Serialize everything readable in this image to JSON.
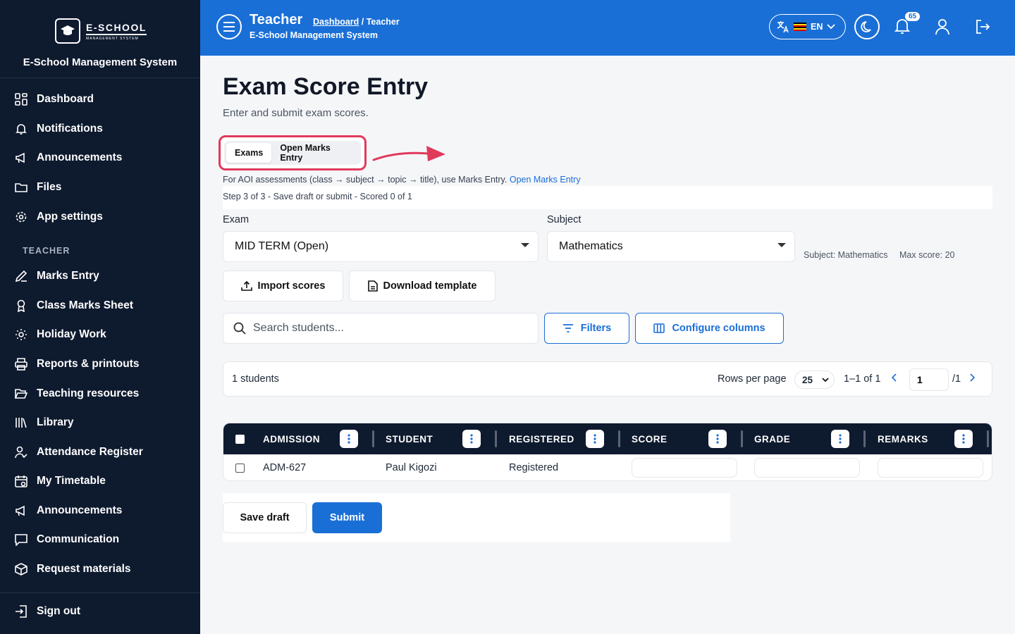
{
  "brand": {
    "logo_line1": "E-SCHOOL",
    "logo_line2": "MANAGEMENT SYSTEM",
    "system_name": "E-School Management System"
  },
  "sidebar": {
    "general": [
      {
        "label": "Dashboard",
        "icon": "dashboard-icon"
      },
      {
        "label": "Notifications",
        "icon": "bell-icon"
      },
      {
        "label": "Announcements",
        "icon": "megaphone-icon"
      },
      {
        "label": "Files",
        "icon": "folder-icon"
      },
      {
        "label": "App settings",
        "icon": "gear-icon"
      }
    ],
    "section_label": "TEACHER",
    "teacher": [
      {
        "label": "Marks Entry",
        "icon": "pen-icon"
      },
      {
        "label": "Class Marks Sheet",
        "icon": "award-icon"
      },
      {
        "label": "Holiday Work",
        "icon": "sun-icon"
      },
      {
        "label": "Reports & printouts",
        "icon": "printer-icon"
      },
      {
        "label": "Teaching resources",
        "icon": "folder-open-icon"
      },
      {
        "label": "Library",
        "icon": "library-icon"
      },
      {
        "label": "Attendance Register",
        "icon": "user-check-icon"
      },
      {
        "label": "My Timetable",
        "icon": "calendar-icon"
      },
      {
        "label": "Announcements",
        "icon": "megaphone-icon"
      },
      {
        "label": "Communication",
        "icon": "chat-icon"
      },
      {
        "label": "Request materials",
        "icon": "package-icon"
      }
    ],
    "sign_out": "Sign out"
  },
  "header": {
    "title": "Teacher",
    "breadcrumb_link": "Dashboard",
    "breadcrumb_sep": " / ",
    "breadcrumb_current": "Teacher",
    "subtitle": "E-School Management System",
    "language": "EN",
    "notification_count": "65"
  },
  "page": {
    "title": "Exam Score Entry",
    "subtitle": "Enter and submit exam scores.",
    "tabs": [
      "Exams",
      "Open Marks Entry"
    ],
    "aoi_note": "For AOI assessments (class → subject → topic → title), use Marks Entry.",
    "aoi_link": "Open Marks Entry",
    "step_text": "Step 3 of 3 - Save draft or submit - Scored 0 of 1"
  },
  "form": {
    "exam_label": "Exam",
    "exam_value": "MID TERM (Open)",
    "subject_label": "Subject",
    "subject_value": "Mathematics",
    "subject_meta": "Subject: Mathematics",
    "max_score_meta": "Max score: 20"
  },
  "toolbar": {
    "import_label": "Import scores",
    "download_label": "Download template",
    "search_placeholder": "Search students...",
    "filters_label": "Filters",
    "configure_label": "Configure columns"
  },
  "pager": {
    "count": "1 students",
    "rows_per_page_label": "Rows per page",
    "rows_per_page": "25",
    "range": "1–1 of 1",
    "current_page": "1",
    "total_pages": "/1"
  },
  "table": {
    "columns": [
      "ADMISSION",
      "STUDENT",
      "REGISTERED",
      "SCORE",
      "GRADE",
      "REMARKS"
    ],
    "rows": [
      {
        "admission": "ADM-627",
        "student": "Paul Kigozi",
        "registered": "Registered",
        "score": "",
        "grade": "",
        "remarks": ""
      }
    ]
  },
  "actions": {
    "save_draft": "Save draft",
    "submit": "Submit"
  },
  "colors": {
    "primary": "#1a6fd6",
    "sidebar_bg": "#0e1a2e",
    "highlight": "#e03a5b"
  }
}
